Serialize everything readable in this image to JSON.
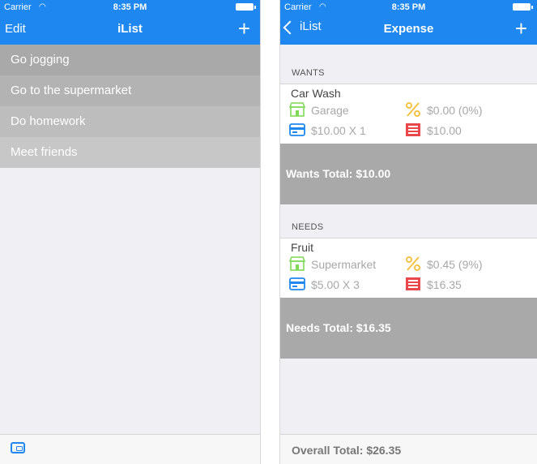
{
  "status": {
    "carrier": "Carrier",
    "time": "8:35 PM"
  },
  "left": {
    "nav": {
      "edit": "Edit",
      "title": "iList",
      "add": "+"
    },
    "items": [
      {
        "label": "Go jogging"
      },
      {
        "label": "Go to the supermarket"
      },
      {
        "label": "Do homework"
      },
      {
        "label": "Meet friends"
      }
    ]
  },
  "right": {
    "nav": {
      "back": "iList",
      "title": "Expense",
      "add": "+"
    },
    "sections": [
      {
        "header": "WANTS",
        "item": {
          "name": "Car Wash",
          "place": "Garage",
          "discount": "$0.00 (0%)",
          "unit": "$10.00 X 1",
          "subtotal": "$10.00"
        },
        "total": "Wants Total: $10.00"
      },
      {
        "header": "NEEDS",
        "item": {
          "name": "Fruit",
          "place": "Supermarket",
          "discount": "$0.45 (9%)",
          "unit": "$5.00 X 3",
          "subtotal": "$16.35"
        },
        "total": "Needs Total: $16.35"
      }
    ],
    "overall": "Overall Total: $26.35"
  },
  "colors": {
    "accent": "#1e88f0",
    "store": "#7ed957",
    "percent": "#f5c242",
    "card": "#1e88f0",
    "list": "#e8474b"
  }
}
